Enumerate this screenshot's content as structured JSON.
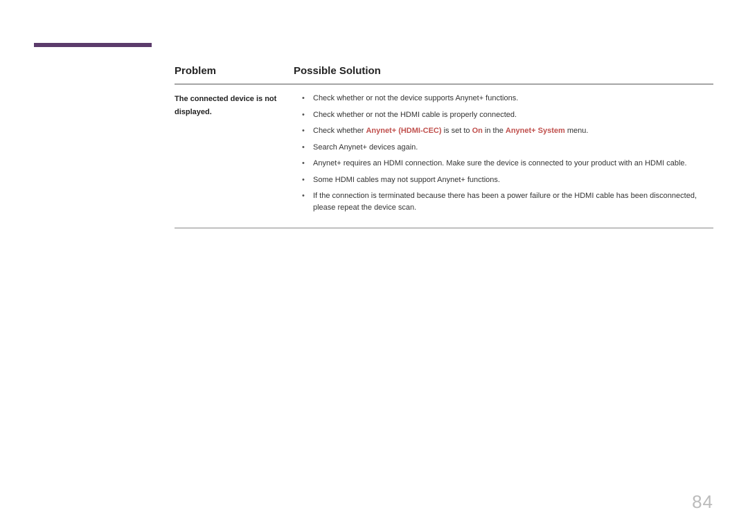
{
  "header": {
    "problem": "Problem",
    "solution": "Possible Solution"
  },
  "row": {
    "problem": "The connected device is not displayed.",
    "solutions": {
      "s1": "Check whether or not the device supports Anynet+ functions.",
      "s2": "Check whether or not the HDMI cable is properly connected.",
      "s3_a": "Check whether ",
      "s3_h1": "Anynet+ (HDMI-CEC)",
      "s3_b": " is set to ",
      "s3_h2": "On",
      "s3_c": " in the ",
      "s3_h3": "Anynet+ System",
      "s3_d": " menu.",
      "s4": "Search Anynet+ devices again.",
      "s5": "Anynet+ requires an HDMI connection. Make sure the device is connected to your product with an HDMI cable.",
      "s6": "Some HDMI cables may not support Anynet+ functions.",
      "s7": "If the connection is terminated because there has been a power failure or the HDMI cable has been disconnected, please repeat the device scan."
    }
  },
  "page_number": "84"
}
